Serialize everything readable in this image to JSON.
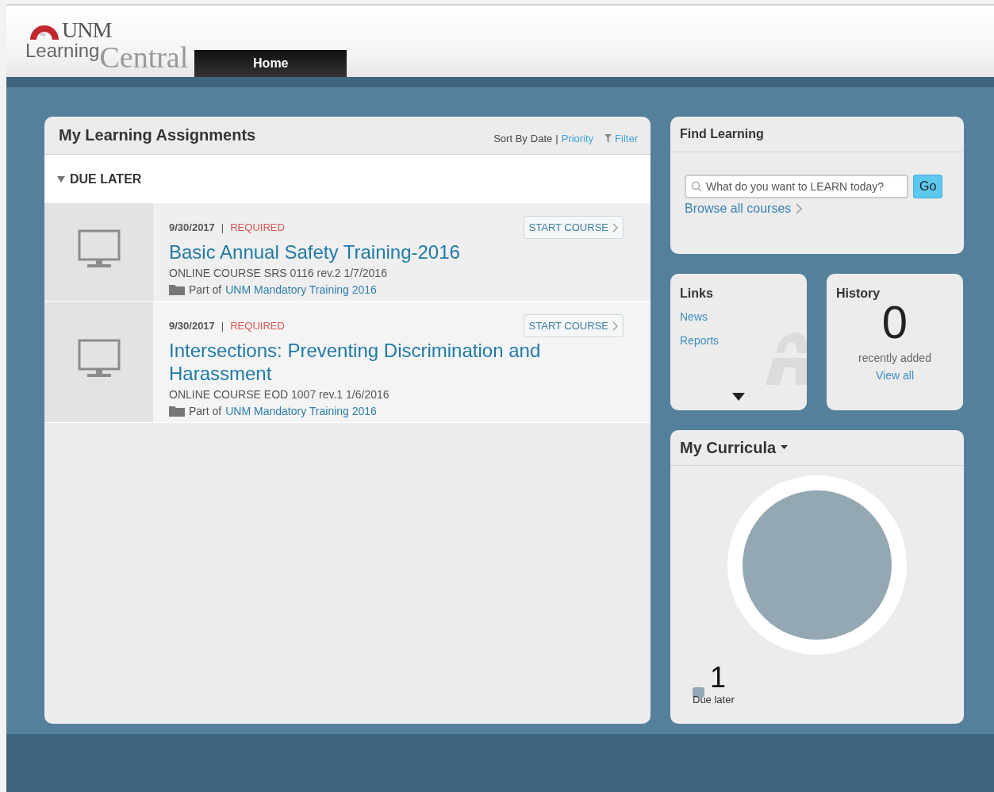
{
  "header": {
    "logo_top": "UNM",
    "logo_left": "Learning",
    "logo_right": "Central",
    "tabs": [
      {
        "label": "Home",
        "selected": true
      }
    ]
  },
  "assignments": {
    "title": "My Learning Assignments",
    "sort_label": "Sort By",
    "sort_separator": "|",
    "sort_options": [
      {
        "label": "Date",
        "selected": true
      },
      {
        "label": "Priority",
        "selected": false
      }
    ],
    "filter": "Filter",
    "group": {
      "label": "DUE LATER",
      "expanded": true
    },
    "courses": [
      {
        "due": "9/30/2017",
        "separator": "|",
        "tag": "REQUIRED",
        "title": "Basic Annual Safety Training-2016",
        "meta": "ONLINE COURSE SRS 0116 rev.2 1/7/2016",
        "part_prefix": "Part of",
        "part_link": "UNM Mandatory Training 2016",
        "action": "START COURSE"
      },
      {
        "due": "9/30/2017",
        "separator": "|",
        "tag": "REQUIRED",
        "title": "Intersections: Preventing Discrimination and Harassment",
        "meta": "ONLINE COURSE EOD 1007 rev.1 1/6/2016",
        "part_prefix": "Part of",
        "part_link": "UNM Mandatory Training 2016",
        "action": "START COURSE"
      }
    ]
  },
  "find_learning": {
    "title": "Find Learning",
    "search": {
      "placeholder": "What do you want to LEARN today?"
    },
    "go": "Go",
    "browse": "Browse all courses"
  },
  "links": {
    "title": "Links",
    "items": [
      "News",
      "Reports"
    ]
  },
  "history": {
    "title": "History",
    "count": "0",
    "caption": "recently added",
    "view_all": "View all"
  },
  "curricula": {
    "title": "My Curricula",
    "chart_data": {
      "type": "pie",
      "categories": [
        "Due later"
      ],
      "series": [
        {
          "color": "#94a8b4",
          "values": [
            1
          ]
        }
      ],
      "data_labels": true
    }
  }
}
